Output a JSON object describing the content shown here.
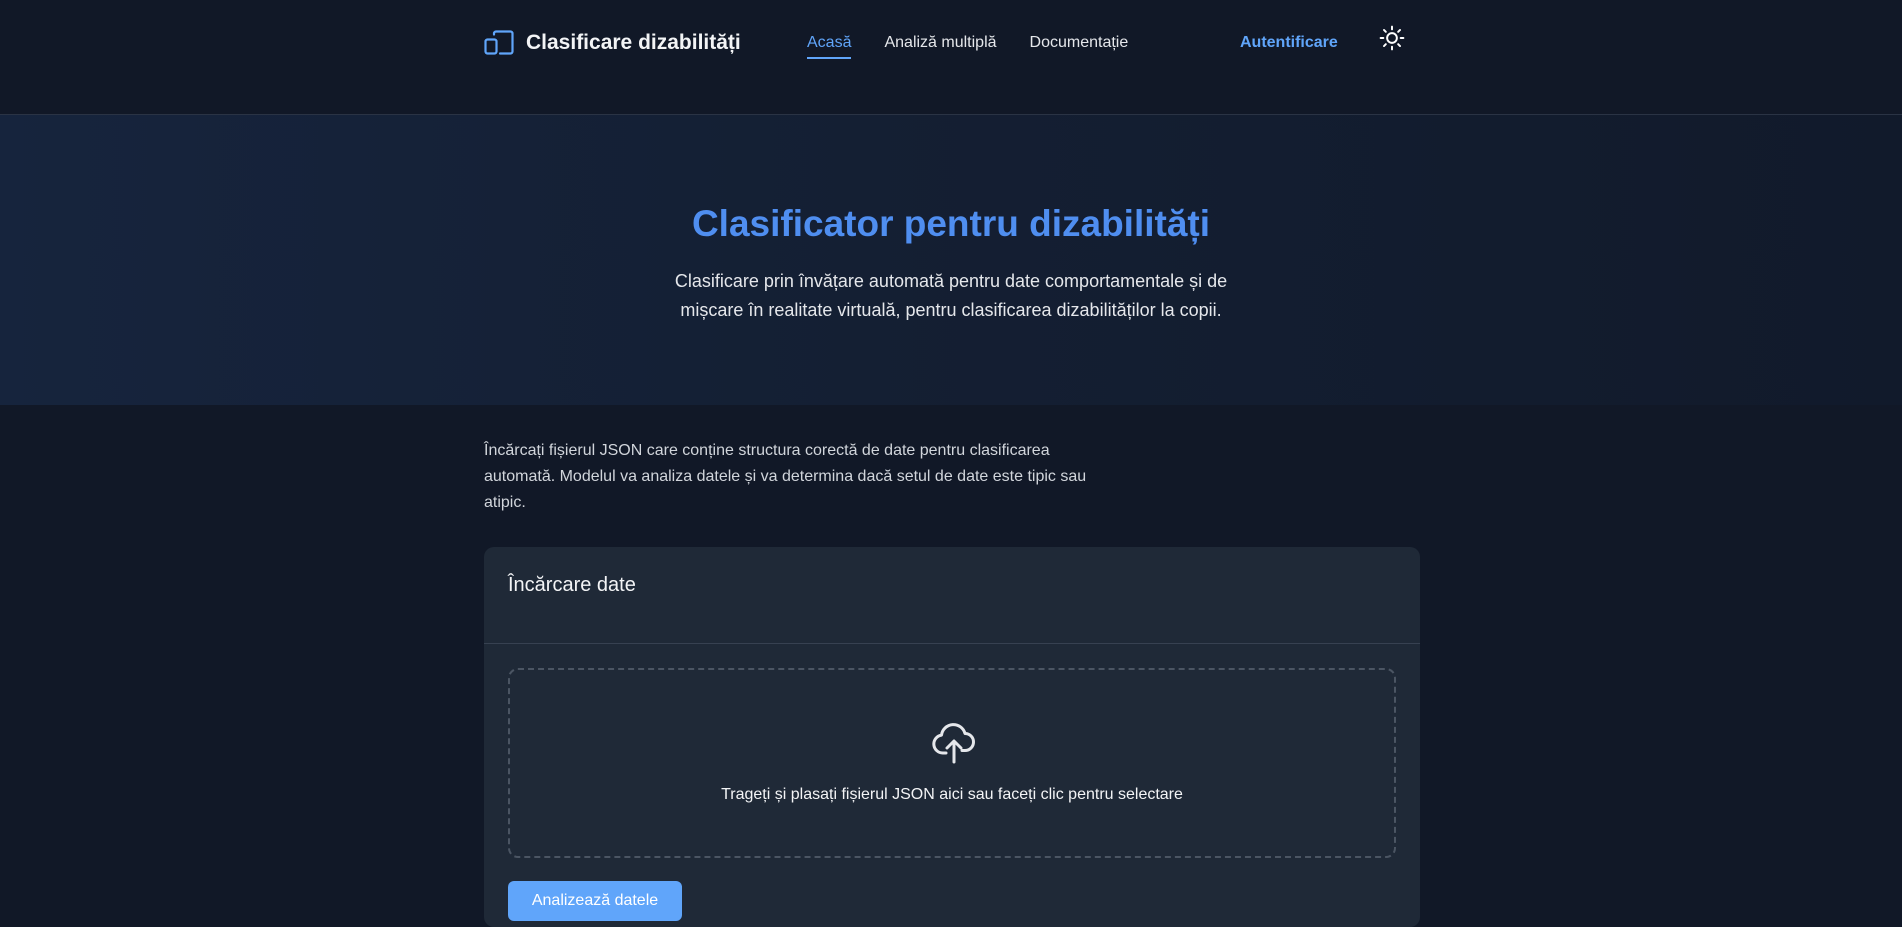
{
  "header": {
    "brand_title": "Clasificare dizabilități",
    "nav": [
      {
        "label": "Acasă",
        "active": true
      },
      {
        "label": "Analiză multiplă",
        "active": false
      },
      {
        "label": "Documentație",
        "active": false
      }
    ],
    "login_label": "Autentificare",
    "theme_icon": "sun-icon"
  },
  "hero": {
    "title": "Clasificator pentru dizabilități",
    "subtitle": "Clasificare prin învățare automată pentru date comportamentale și de mișcare în realitate virtuală, pentru clasificarea dizabilităților la copii."
  },
  "main": {
    "intro": "Încărcați fișierul JSON care conține structura corectă de date pentru clasificarea automată. Modelul va analiza datele și va determina dacă setul de date este tipic sau atipic.",
    "card": {
      "title": "Încărcare date",
      "dropzone_text": "Trageți și plasați fișierul JSON aici sau faceți clic pentru selectare",
      "upload_icon": "cloud-upload-icon",
      "analyze_label": "Analizează datele"
    }
  },
  "colors": {
    "accent": "#60a5fa",
    "title_blue": "#4f8ef0",
    "background": "#111827",
    "card": "#1f2937"
  }
}
